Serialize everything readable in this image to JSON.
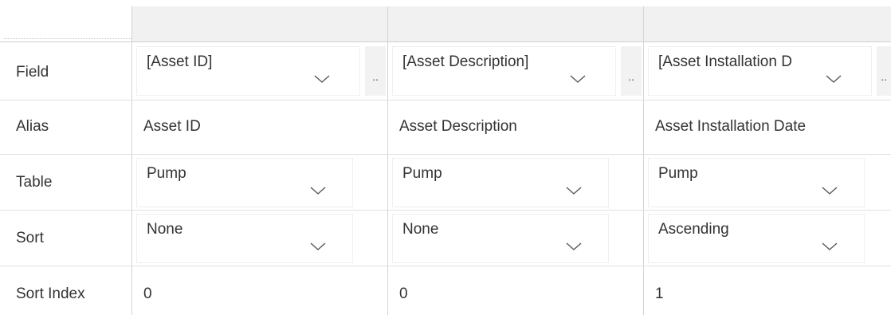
{
  "rows": {
    "field": "Field",
    "alias": "Alias",
    "table": "Table",
    "sort": "Sort",
    "sort_index": "Sort Index"
  },
  "columns": [
    {
      "field": "[Asset ID]",
      "alias": "Asset ID",
      "table": "Pump",
      "sort": "None",
      "sort_index": "0"
    },
    {
      "field": "[Asset Description]",
      "alias": "Asset Description",
      "table": "Pump",
      "sort": "None",
      "sort_index": "0"
    },
    {
      "field": "[Asset Installation D",
      "alias": "Asset Installation Date",
      "table": "Pump",
      "sort": "Ascending",
      "sort_index": "1"
    }
  ],
  "ellipsis_label": "..",
  "icons": {
    "dropdown": "chevron-down-icon"
  }
}
